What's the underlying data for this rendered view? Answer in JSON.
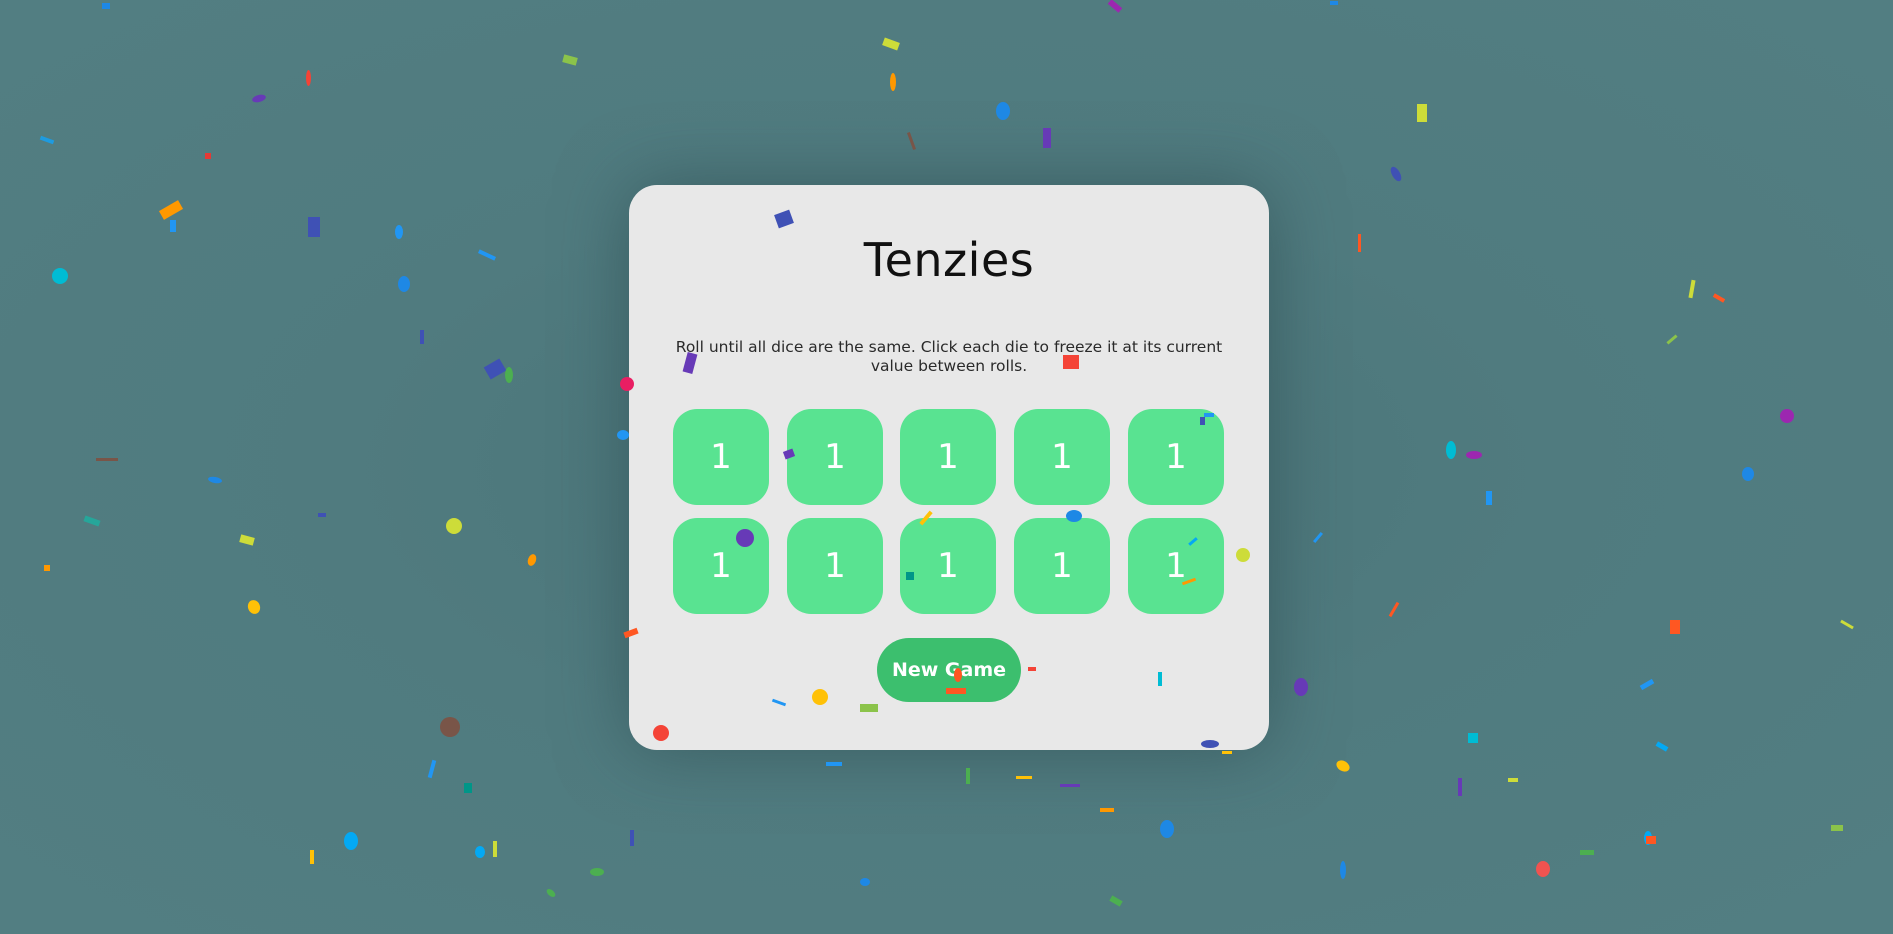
{
  "game": {
    "title": "Tenzies",
    "instructions": "Roll until all dice are the same. Click each die to freeze it at its current value between rolls.",
    "dice": [
      "1",
      "1",
      "1",
      "1",
      "1",
      "1",
      "1",
      "1",
      "1",
      "1"
    ],
    "new_game_label": "New Game"
  },
  "colors": {
    "background": "#507b7f",
    "card": "#e8e8e8",
    "die": "#59e391",
    "button": "#3cbf6e"
  }
}
